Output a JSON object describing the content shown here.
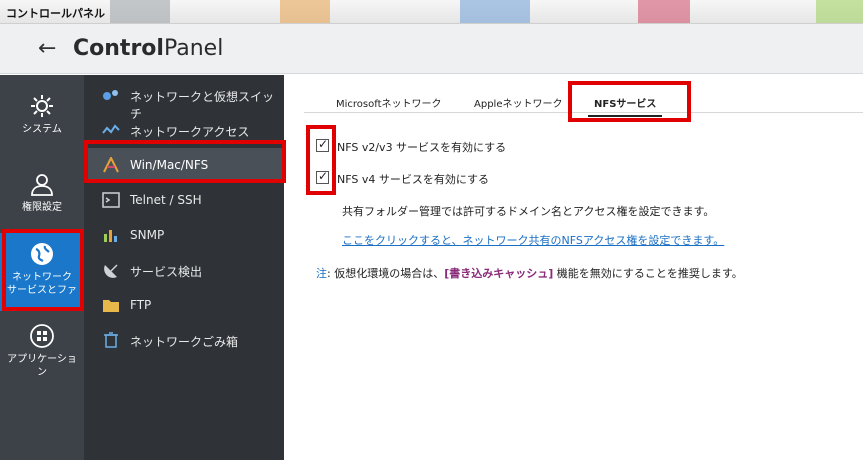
{
  "window": {
    "title": "コントロールパネル"
  },
  "header": {
    "back_icon": "←",
    "title_bold": "Control",
    "title_rest": "Panel"
  },
  "rail": [
    {
      "name": "system",
      "label": "システム",
      "icon": "gear-icon"
    },
    {
      "name": "privilege",
      "label": "権限設定",
      "icon": "user-icon"
    },
    {
      "name": "network",
      "label": "ネットワーク\nサービスとファ",
      "icon": "globe-icon",
      "active": true
    },
    {
      "name": "applications",
      "label": "アプリケーショ\nン",
      "icon": "apps-icon"
    }
  ],
  "submenu": [
    {
      "label": "ネットワークと仮想スイッチ",
      "icon": "network-switch-icon"
    },
    {
      "label": "ネットワークアクセス",
      "icon": "network-access-icon"
    },
    {
      "label": "Win/Mac/NFS",
      "icon": "win-mac-nfs-icon",
      "active": true
    },
    {
      "label": "Telnet / SSH",
      "icon": "terminal-icon"
    },
    {
      "label": "SNMP",
      "icon": "snmp-icon"
    },
    {
      "label": "サービス検出",
      "icon": "satellite-dish-icon"
    },
    {
      "label": "FTP",
      "icon": "ftp-folder-icon"
    },
    {
      "label": "ネットワークごみ箱",
      "icon": "recycle-bin-icon"
    }
  ],
  "tabs": [
    {
      "label": "Microsoftネットワーク"
    },
    {
      "label": "Appleネットワーク"
    },
    {
      "label": "NFSサービス",
      "active": true
    }
  ],
  "nfs": {
    "v2v3_label": "NFS v2/v3 サービスを有効にする",
    "v2v3_checked": true,
    "v4_label": "NFS v4 サービスを有効にする",
    "v4_checked": true,
    "description": "共有フォルダー管理では許可するドメイン名とアクセス権を設定できます。",
    "link_text": "ここをクリックすると、ネットワーク共有のNFSアクセス権を設定できます。",
    "note_label": "注",
    "note_prefix": ": 仮想化環境の場合は、",
    "note_link": "[書き込みキャッシュ]",
    "note_suffix": " 機能を無効にすることを推奨します。"
  },
  "colors": {
    "highlight": "#e00000",
    "accent": "#1a77c9",
    "link": "#1a6fc4"
  }
}
